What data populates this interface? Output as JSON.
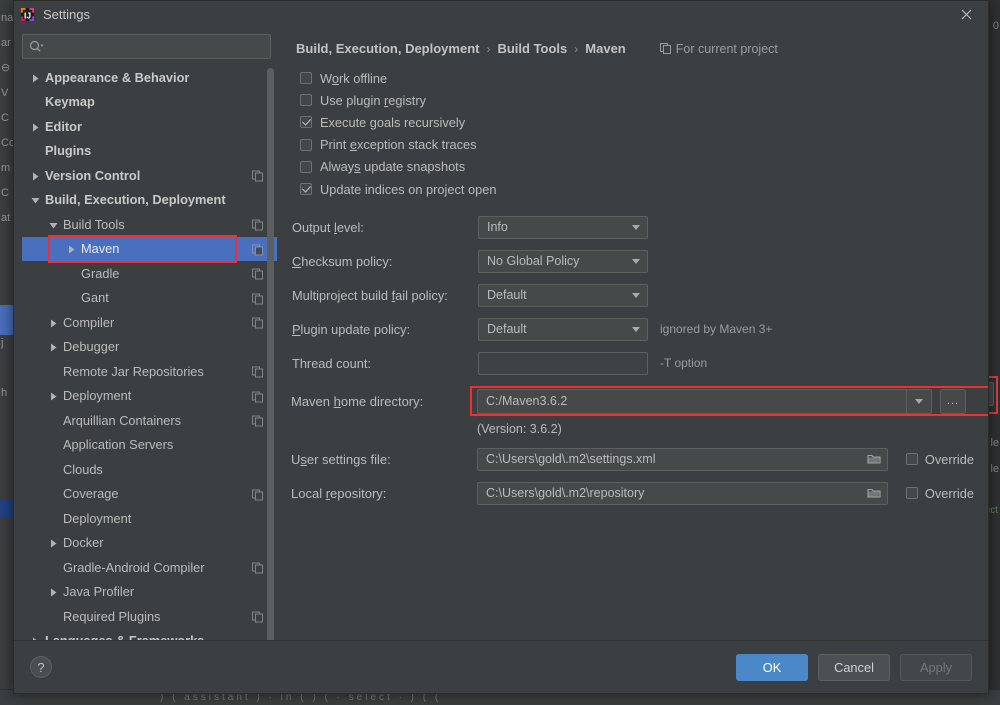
{
  "window": {
    "title": "Settings",
    "logo_icon": "intellij-idea-logo",
    "close_icon": "close-icon"
  },
  "search": {
    "placeholder": "",
    "value": "",
    "icon": "search-icon",
    "dropdown_icon": "chevron-down-icon"
  },
  "sidebar": {
    "scrollbar": "vertical-scrollbar",
    "items": [
      {
        "label": "Appearance & Behavior",
        "indent": 0,
        "arrow": "collapsed",
        "bold": true,
        "copy": false,
        "selected": false
      },
      {
        "label": "Keymap",
        "indent": 0,
        "arrow": "none",
        "bold": true,
        "copy": false,
        "selected": false
      },
      {
        "label": "Editor",
        "indent": 0,
        "arrow": "collapsed",
        "bold": true,
        "copy": false,
        "selected": false
      },
      {
        "label": "Plugins",
        "indent": 0,
        "arrow": "none",
        "bold": true,
        "copy": false,
        "selected": false
      },
      {
        "label": "Version Control",
        "indent": 0,
        "arrow": "collapsed",
        "bold": true,
        "copy": true,
        "selected": false
      },
      {
        "label": "Build, Execution, Deployment",
        "indent": 0,
        "arrow": "expanded",
        "bold": true,
        "copy": false,
        "selected": false
      },
      {
        "label": "Build Tools",
        "indent": 1,
        "arrow": "expanded",
        "bold": false,
        "copy": true,
        "selected": false
      },
      {
        "label": "Maven",
        "indent": 2,
        "arrow": "collapsed",
        "bold": false,
        "copy": true,
        "selected": true
      },
      {
        "label": "Gradle",
        "indent": 2,
        "arrow": "none",
        "bold": false,
        "copy": true,
        "selected": false
      },
      {
        "label": "Gant",
        "indent": 2,
        "arrow": "none",
        "bold": false,
        "copy": true,
        "selected": false
      },
      {
        "label": "Compiler",
        "indent": 1,
        "arrow": "collapsed",
        "bold": false,
        "copy": true,
        "selected": false
      },
      {
        "label": "Debugger",
        "indent": 1,
        "arrow": "collapsed",
        "bold": false,
        "copy": false,
        "selected": false
      },
      {
        "label": "Remote Jar Repositories",
        "indent": 1,
        "arrow": "none",
        "bold": false,
        "copy": true,
        "selected": false
      },
      {
        "label": "Deployment",
        "indent": 1,
        "arrow": "collapsed",
        "bold": false,
        "copy": true,
        "selected": false
      },
      {
        "label": "Arquillian Containers",
        "indent": 1,
        "arrow": "none",
        "bold": false,
        "copy": true,
        "selected": false
      },
      {
        "label": "Application Servers",
        "indent": 1,
        "arrow": "none",
        "bold": false,
        "copy": false,
        "selected": false
      },
      {
        "label": "Clouds",
        "indent": 1,
        "arrow": "none",
        "bold": false,
        "copy": false,
        "selected": false
      },
      {
        "label": "Coverage",
        "indent": 1,
        "arrow": "none",
        "bold": false,
        "copy": true,
        "selected": false
      },
      {
        "label": "Deployment",
        "indent": 1,
        "arrow": "none",
        "bold": false,
        "copy": false,
        "selected": false
      },
      {
        "label": "Docker",
        "indent": 1,
        "arrow": "collapsed",
        "bold": false,
        "copy": false,
        "selected": false
      },
      {
        "label": "Gradle-Android Compiler",
        "indent": 1,
        "arrow": "none",
        "bold": false,
        "copy": true,
        "selected": false
      },
      {
        "label": "Java Profiler",
        "indent": 1,
        "arrow": "collapsed",
        "bold": false,
        "copy": false,
        "selected": false
      },
      {
        "label": "Required Plugins",
        "indent": 1,
        "arrow": "none",
        "bold": false,
        "copy": true,
        "selected": false
      },
      {
        "label": "Languages & Frameworks",
        "indent": 0,
        "arrow": "collapsed",
        "bold": true,
        "copy": false,
        "selected": false
      }
    ]
  },
  "breadcrumb": {
    "parts": [
      "Build, Execution, Deployment",
      "Build Tools",
      "Maven"
    ],
    "separator": "›",
    "for_project_label": "For current project",
    "for_project_icon": "copy-icon"
  },
  "checkboxes": [
    {
      "label": "Work offline",
      "mnemonic": "o",
      "checked": false
    },
    {
      "label": "Use plugin registry",
      "mnemonic": "r",
      "checked": false
    },
    {
      "label": "Execute goals recursively",
      "mnemonic": "g",
      "checked": true
    },
    {
      "label": "Print exception stack traces",
      "mnemonic": "e",
      "checked": false
    },
    {
      "label": "Always update snapshots",
      "mnemonic": "s",
      "checked": false
    },
    {
      "label": "Update indices on project open",
      "mnemonic": "",
      "checked": true
    }
  ],
  "combos": [
    {
      "label": "Output level:",
      "mnemonic": "l",
      "value": "Info",
      "hint": ""
    },
    {
      "label": "Checksum policy:",
      "mnemonic": "C",
      "value": "No Global Policy",
      "hint": ""
    },
    {
      "label": "Multiproject build fail policy:",
      "mnemonic": "f",
      "value": "Default",
      "hint": ""
    },
    {
      "label": "Plugin update policy:",
      "mnemonic": "P",
      "value": "Default",
      "hint": "ignored by Maven 3+"
    }
  ],
  "thread_count": {
    "label": "Thread count:",
    "value": "",
    "hint": "-T option"
  },
  "maven_home": {
    "label": "Maven home directory:",
    "mnemonic": "h",
    "value": "C:/Maven3.6.2",
    "dropdown_icon": "chevron-down-icon",
    "browse_label": "...",
    "version_note": "(Version: 3.6.2)",
    "highlight_color": "#f03030"
  },
  "paths": [
    {
      "label": "User settings file:",
      "mnemonic": "s",
      "value": "C:\\Users\\gold\\.m2\\settings.xml",
      "folder_icon": "folder-icon",
      "override_label": "Override",
      "override_checked": false
    },
    {
      "label": "Local repository:",
      "mnemonic": "r",
      "value": "C:\\Users\\gold\\.m2\\repository",
      "folder_icon": "folder-icon",
      "override_label": "Override",
      "override_checked": false
    }
  ],
  "footer": {
    "help_label": "?",
    "ok_label": "OK",
    "cancel_label": "Cancel",
    "apply_label": "Apply",
    "apply_disabled": true,
    "primary_color": "#4a88c7"
  },
  "background": {
    "left_fragments": [
      "na",
      "ar",
      "⊖",
      "V",
      "C",
      "Co",
      "m",
      "C",
      "at",
      "",
      "",
      "",
      "",
      "j",
      "",
      "h"
    ],
    "right_fragments": [
      "0",
      "le",
      "le"
    ],
    "bottom_code": ") ( assistant ) · in ( ) ( · select · ) ( (",
    "bottom_org": "select"
  }
}
